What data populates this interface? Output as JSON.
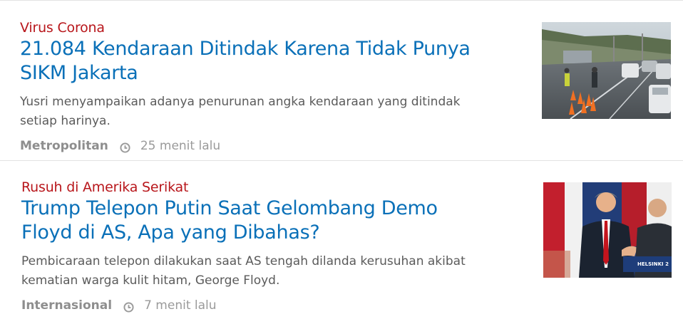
{
  "articles": [
    {
      "category": "Virus Corona",
      "headline_line1": "21.084 Kendaraan Ditindak Karena Tidak Punya",
      "headline_line2": "SIKM Jakarta",
      "summary_line1": "Yusri menyampaikan adanya penurunan angka kendaraan yang ditindak",
      "summary_line2": "setiap harinya.",
      "section": "Metropolitan",
      "time": "25 menit lalu",
      "thumbnail_icon": "traffic-checkpoint-photo"
    },
    {
      "category": "Rusuh di Amerika Serikat",
      "headline_line1": "Trump Telepon Putin Saat Gelombang Demo",
      "headline_line2": "Floyd di AS, Apa yang Dibahas?",
      "summary_line1": "Pembicaraan telepon dilakukan saat AS tengah dilanda kerusuhan akibat",
      "summary_line2": "kematian warga kulit hitam, George Floyd.",
      "section": "Internasional",
      "time": "7 menit lalu",
      "thumbnail_icon": "handshake-photo",
      "thumbnail_caption": "HELSINKI 2"
    }
  ],
  "colors": {
    "category": "#b8161b",
    "headline": "#0a70b8",
    "summary": "#5b5b5b",
    "meta": "#9a9a9a"
  }
}
